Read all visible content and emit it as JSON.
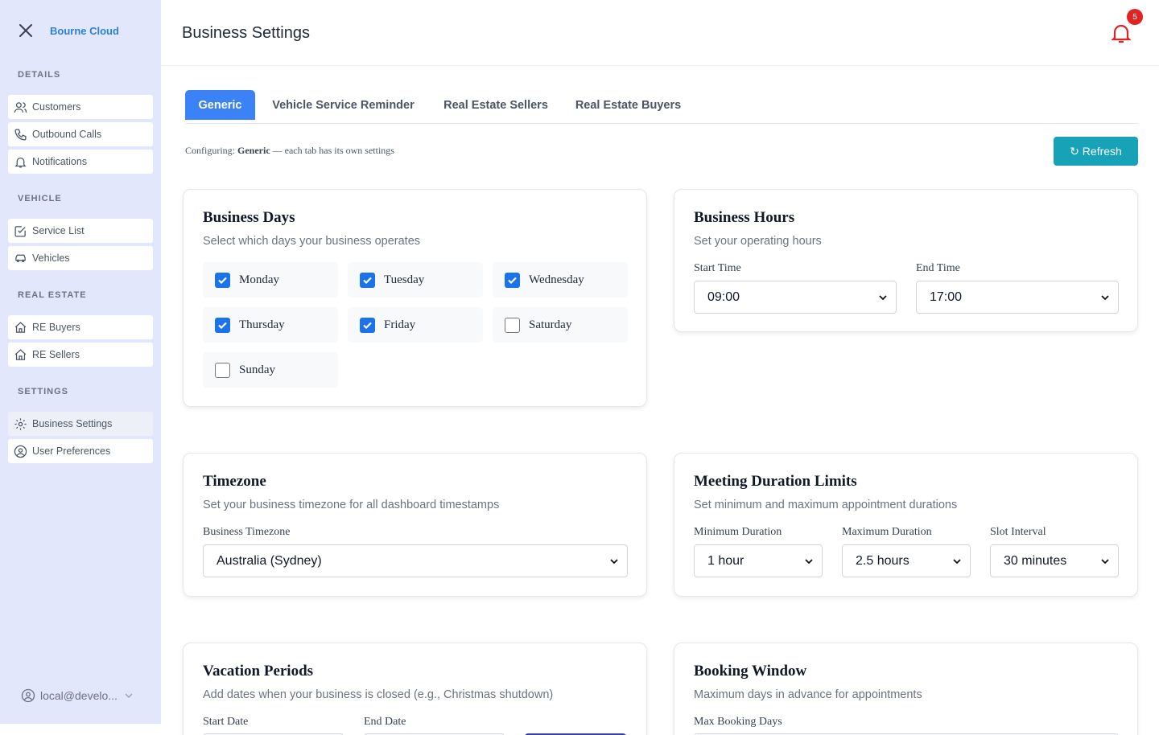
{
  "sidebar": {
    "brand": "Bourne Cloud",
    "sections": {
      "details": "DETAILS",
      "vehicle": "VEHICLE",
      "real_estate": "REAL ESTATE",
      "settings": "SETTINGS"
    },
    "items": {
      "customers": "Customers",
      "outbound_calls": "Outbound Calls",
      "notifications": "Notifications",
      "service_list": "Service List",
      "vehicles": "Vehicles",
      "re_buyers": "RE Buyers",
      "re_sellers": "RE Sellers",
      "business_settings": "Business Settings",
      "user_preferences": "User Preferences"
    },
    "user": "local@develo..."
  },
  "header": {
    "title": "Business Settings",
    "notification_count": "5"
  },
  "tabs": {
    "generic": "Generic",
    "vehicle_service_reminder": "Vehicle Service Reminder",
    "real_estate_sellers": "Real Estate Sellers",
    "real_estate_buyers": "Real Estate Buyers"
  },
  "config": {
    "prefix": "Configuring:",
    "tab": "Generic",
    "suffix": "— each tab has its own settings",
    "refresh_label": "↻ Refresh"
  },
  "business_days": {
    "title": "Business Days",
    "subtitle": "Select which days your business operates",
    "days": {
      "monday": "Monday",
      "tuesday": "Tuesday",
      "wednesday": "Wednesday",
      "thursday": "Thursday",
      "friday": "Friday",
      "saturday": "Saturday",
      "sunday": "Sunday"
    },
    "checked": [
      "Monday",
      "Tuesday",
      "Wednesday",
      "Thursday",
      "Friday"
    ]
  },
  "business_hours": {
    "title": "Business Hours",
    "subtitle": "Set your operating hours",
    "start_label": "Start Time",
    "start_value": "09:00",
    "end_label": "End Time",
    "end_value": "17:00"
  },
  "timezone": {
    "title": "Timezone",
    "subtitle": "Set your business timezone for all dashboard timestamps",
    "label": "Business Timezone",
    "value": "Australia (Sydney)"
  },
  "meeting_duration": {
    "title": "Meeting Duration Limits",
    "subtitle": "Set minimum and maximum appointment durations",
    "min_label": "Minimum Duration",
    "min_value": "1 hour",
    "max_label": "Maximum Duration",
    "max_value": "2.5 hours",
    "slot_label": "Slot Interval",
    "slot_value": "30 minutes"
  },
  "vacation": {
    "title": "Vacation Periods",
    "subtitle": "Add dates when your business is closed (e.g., Christmas shutdown)",
    "start_label": "Start Date",
    "end_label": "End Date"
  },
  "booking_window": {
    "title": "Booking Window",
    "subtitle": "Maximum days in advance for appointments",
    "label": "Max Booking Days"
  },
  "colors": {
    "sidebar_bg": "#e3e7fb",
    "brand": "#2b7fd8",
    "tab_active": "#3b82f6",
    "refresh": "#17a2b8",
    "checkbox": "#1a73e8",
    "bell": "#e02424"
  }
}
